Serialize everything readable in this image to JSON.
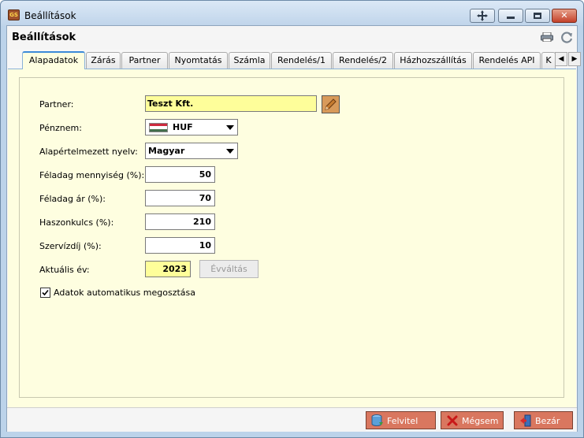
{
  "window": {
    "title": "Beállítások",
    "app_icon_text": "GS"
  },
  "header": {
    "page_title": "Beállítások"
  },
  "tabs": [
    {
      "label": "Alapadatok",
      "active": true
    },
    {
      "label": "Zárás"
    },
    {
      "label": "Partner"
    },
    {
      "label": "Nyomtatás"
    },
    {
      "label": "Számla"
    },
    {
      "label": "Rendelés/1"
    },
    {
      "label": "Rendelés/2"
    },
    {
      "label": "Házhozszállítás"
    },
    {
      "label": "Rendelés API"
    },
    {
      "label": "K"
    }
  ],
  "form": {
    "partner": {
      "label": "Partner:",
      "value": "Teszt Kft."
    },
    "currency": {
      "label": "Pénznem:",
      "value": "HUF"
    },
    "language": {
      "label": "Alapértelmezett nyelv:",
      "value": "Magyar"
    },
    "task_quantity": {
      "label": "Féladag mennyiség (%):",
      "value": "50"
    },
    "task_price": {
      "label": "Féladag ár (%):",
      "value": "70"
    },
    "margin": {
      "label": "Haszonkulcs (%):",
      "value": "210"
    },
    "service_fee": {
      "label": "Szervízdíj (%):",
      "value": "10"
    },
    "current_year": {
      "label": "Aktuális év:",
      "value": "2023",
      "button": "Évváltás"
    },
    "share_data": {
      "label": "Adatok automatikus megosztása",
      "checked": true
    }
  },
  "actions": {
    "save": "Felvitel",
    "cancel": "Mégsem",
    "close": "Bezár"
  },
  "colors": {
    "panel_bg": "#fefee0",
    "highlight_field": "#fefe9a",
    "action_button": "#d9775f",
    "active_tab_accent": "#3c8ad8"
  }
}
